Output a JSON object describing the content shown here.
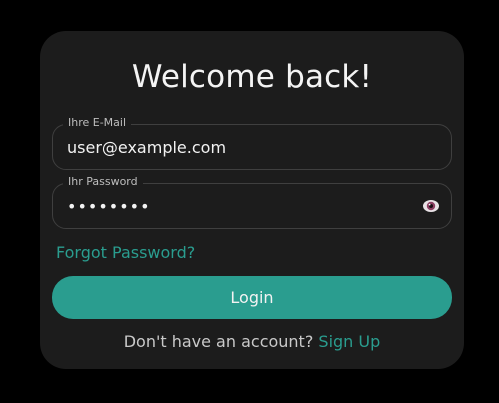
{
  "header": {
    "title": "Welcome back!"
  },
  "form": {
    "email": {
      "label": "Ihre E-Mail",
      "value": "user@example.com"
    },
    "password": {
      "label": "Ihr Password",
      "value": "••••••••",
      "toggle_icon": "eye-icon"
    },
    "forgot_link": "Forgot Password?",
    "login_label": "Login"
  },
  "footer": {
    "prompt": "Don't have an account?",
    "signup_link": "Sign Up"
  },
  "colors": {
    "background": "#000000",
    "card": "#1c1c1c",
    "accent": "#2a9d8f",
    "text": "#f2f2f2",
    "muted_text": "#c9c9c9",
    "field_border": "#3f3f3f"
  }
}
